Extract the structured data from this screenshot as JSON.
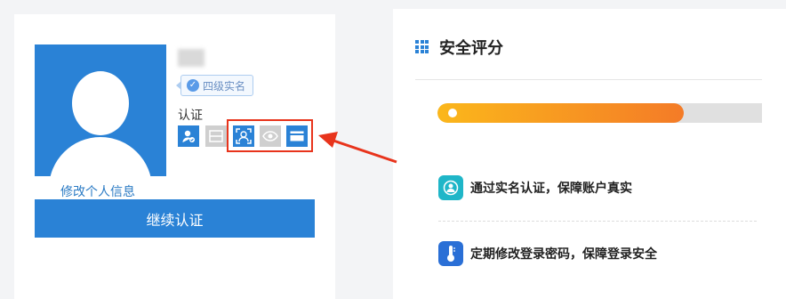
{
  "profile": {
    "realname_badge": "四级实名",
    "auth_label": "认证",
    "edit_link": "修改个人信息",
    "continue_button": "继续认证",
    "auth_icons": [
      "person-verify-icon",
      "id-card-icon",
      "face-scan-icon",
      "eye-icon",
      "bank-card-icon"
    ]
  },
  "security": {
    "title": "安全评分",
    "score_progress": 0.76,
    "tips": [
      {
        "icon": "user-circle-icon",
        "text": "通过实名认证，保障账户真实"
      },
      {
        "icon": "thermometer-icon",
        "text": "定期修改登录密码，保障登录安全"
      }
    ]
  },
  "colors": {
    "primary": "#2a82d6",
    "highlight": "#e8341c",
    "progress_start": "#fbb71b",
    "progress_end": "#f47b27"
  }
}
